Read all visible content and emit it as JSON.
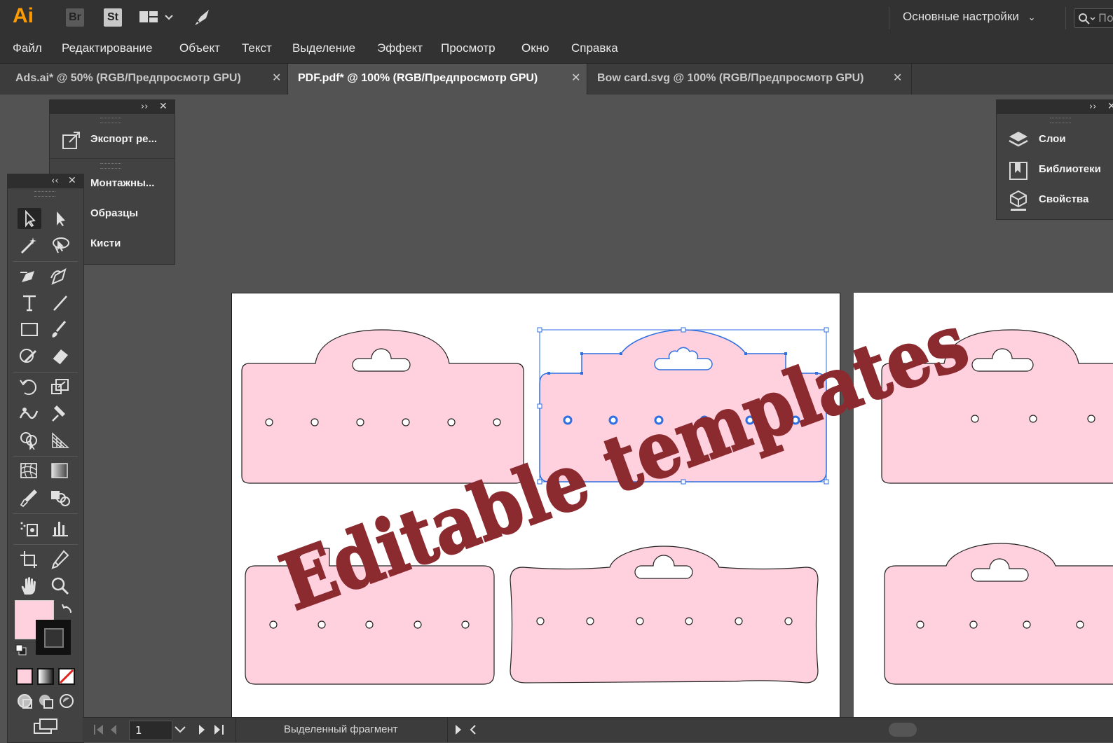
{
  "app": {
    "logo": "Ai",
    "bridge": "Br",
    "stock": "St",
    "workspace": "Основные настройки",
    "search_placeholder": "По"
  },
  "menu": [
    "Файл",
    "Редактирование",
    "Объект",
    "Текст",
    "Выделение",
    "Эффект",
    "Просмотр",
    "Окно",
    "Справка"
  ],
  "tabs": [
    {
      "label": "Ads.ai* @ 50% (RGB/Предпросмотр GPU)",
      "close": "✕"
    },
    {
      "label": "PDF.pdf* @ 100% (RGB/Предпросмотр GPU)",
      "close": "✕"
    },
    {
      "label": "Bow card.svg @ 100% (RGB/Предпросмотр GPU)",
      "close": "✕"
    }
  ],
  "left_panel": {
    "items": [
      "Экспорт ре...",
      "Монтажны...",
      "Образцы",
      "Кисти"
    ]
  },
  "right_panel": {
    "items": [
      "Слои",
      "Библиотеки",
      "Свойства"
    ]
  },
  "status": {
    "page": "1",
    "info": "Выделенный фрагмент"
  },
  "overlay": {
    "text": "Editable templates"
  },
  "colors": {
    "accent": "#ff9a00",
    "card_fill": "#ffd0de",
    "selection": "#2f6fe0",
    "overlay_text": "#8b2a2f"
  }
}
